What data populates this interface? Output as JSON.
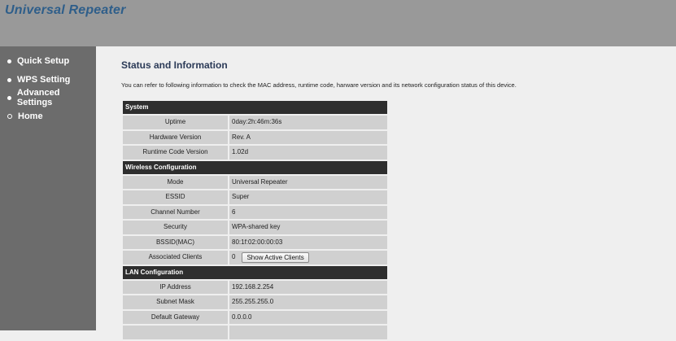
{
  "header": {
    "title": "Universal Repeater"
  },
  "sidebar": {
    "items": [
      {
        "label": "Quick Setup",
        "bullet": "filled"
      },
      {
        "label": "WPS Setting",
        "bullet": "filled"
      },
      {
        "label": "Advanced Settings",
        "bullet": "filled"
      },
      {
        "label": "Home",
        "bullet": "hollow"
      }
    ]
  },
  "main": {
    "title": "Status and Information",
    "description": "You can refer to following information to check the MAC address, runtime code, harware version and its network configuration status of this device.",
    "sections": [
      {
        "title": "System",
        "rows": [
          {
            "label": "Uptime",
            "value": "0day:2h:46m:36s"
          },
          {
            "label": "Hardware Version",
            "value": "Rev. A"
          },
          {
            "label": "Runtime Code Version",
            "value": "1.02d"
          }
        ]
      },
      {
        "title": "Wireless Configuration",
        "rows": [
          {
            "label": "Mode",
            "value": "Universal Repeater"
          },
          {
            "label": "ESSID",
            "value": "Super"
          },
          {
            "label": "Channel Number",
            "value": "6"
          },
          {
            "label": "Security",
            "value": "WPA-shared key"
          },
          {
            "label": "BSSID(MAC)",
            "value": "80:1f:02:00:00:03"
          },
          {
            "label": "Associated Clients",
            "value": "0",
            "button": "Show Active Clients"
          }
        ]
      },
      {
        "title": "LAN Configuration",
        "rows": [
          {
            "label": "IP Address",
            "value": "192.168.2.254"
          },
          {
            "label": "Subnet Mask",
            "value": "255.255.255.0"
          },
          {
            "label": "Default Gateway",
            "value": "0.0.0.0"
          },
          {
            "label": "",
            "value": ""
          }
        ]
      }
    ]
  },
  "colors": {
    "header_bg": "#999999",
    "sidebar_bg": "#6c6c6c",
    "content_bg": "#efefef",
    "title_text": "#2e5e8a",
    "section_header_bg": "#2e2e2e",
    "cell_bg": "#d0d0d0"
  }
}
